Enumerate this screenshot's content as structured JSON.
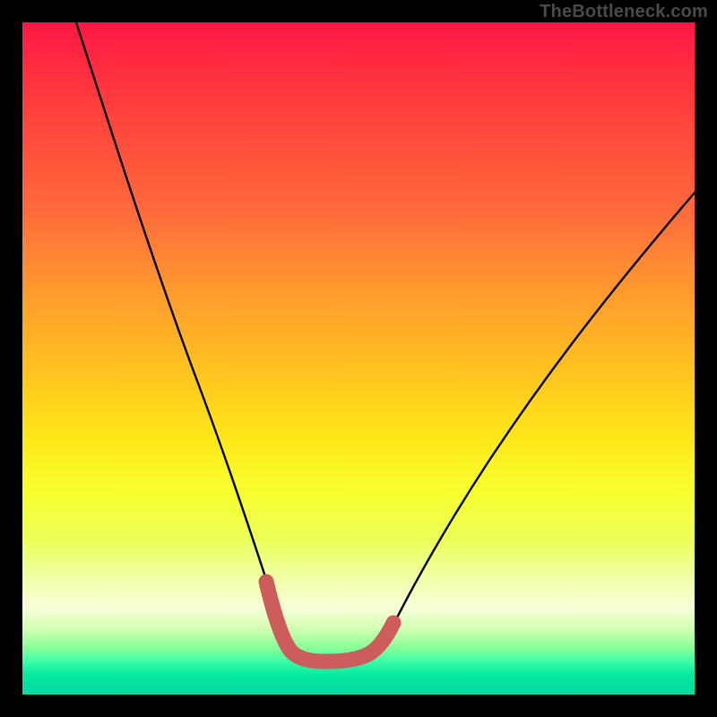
{
  "watermark": "TheBottleneck.com",
  "chart_data": {
    "type": "line",
    "title": "",
    "xlabel": "",
    "ylabel": "",
    "xlim": [
      0,
      100
    ],
    "ylim": [
      0,
      100
    ],
    "grid": false,
    "legend": false,
    "series": [
      {
        "name": "bottleneck-curve",
        "x": [
          0,
          5,
          10,
          15,
          20,
          25,
          28,
          31,
          34,
          37,
          38.5,
          40.5,
          43,
          46,
          49,
          52,
          55,
          58,
          62,
          68,
          76,
          85,
          95,
          100
        ],
        "y": [
          100,
          88,
          76,
          64,
          52,
          40,
          30,
          22,
          15,
          8,
          5.5,
          5,
          5,
          5,
          5.5,
          7,
          10,
          14,
          19,
          28,
          40,
          52,
          65,
          72
        ]
      }
    ],
    "annotations": [
      {
        "name": "valley-highlight",
        "type": "path",
        "color": "#cd5c5c",
        "x": [
          37,
          38.5,
          40.5,
          43,
          46,
          49,
          52
        ],
        "y": [
          8,
          5.5,
          5,
          5,
          5,
          5.5,
          7
        ]
      }
    ],
    "background": {
      "type": "vertical-gradient",
      "stops": [
        {
          "pos": 0.0,
          "color": "#ff1744"
        },
        {
          "pos": 0.5,
          "color": "#ffdd1a"
        },
        {
          "pos": 0.9,
          "color": "#e9ffc0"
        },
        {
          "pos": 1.0,
          "color": "#06d9a0"
        }
      ]
    }
  }
}
